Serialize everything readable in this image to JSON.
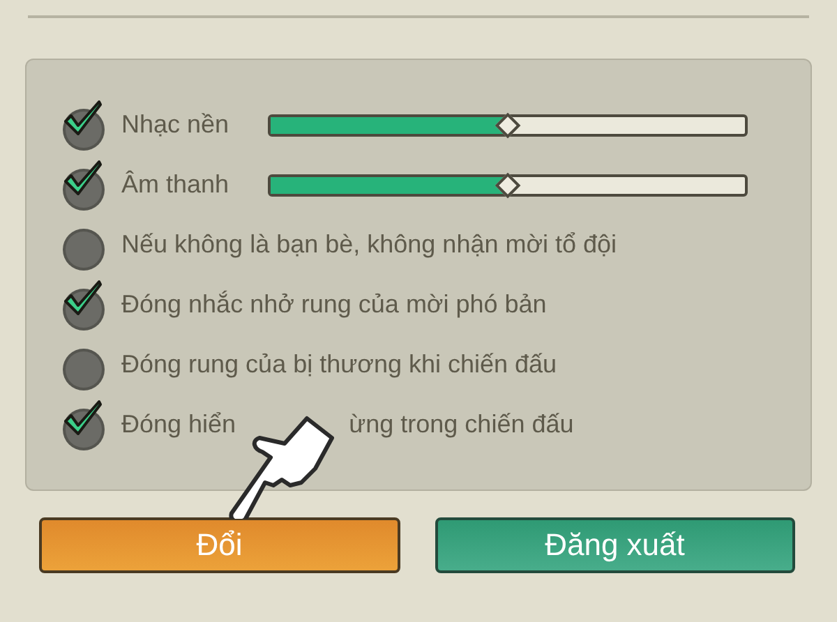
{
  "settings": [
    {
      "kind": "slider",
      "label": "Nhạc nền",
      "checked": true,
      "level": 0.5
    },
    {
      "kind": "slider",
      "label": "Âm thanh",
      "checked": true,
      "level": 0.5
    },
    {
      "kind": "toggle",
      "label": "Nếu không là bạn bè, không nhận mời tổ đội",
      "checked": false
    },
    {
      "kind": "toggle",
      "label": "Đóng nhắc nhở rung của mời phó bản",
      "checked": true
    },
    {
      "kind": "toggle",
      "label": "Đóng rung của bị thương khi chiến đấu",
      "checked": false
    },
    {
      "kind": "toggle",
      "label_parts": [
        "Đóng hiển",
        "ừng trong chiến đấu"
      ],
      "checked": true
    }
  ],
  "buttons": [
    {
      "label": "Đổi",
      "kind": "orange"
    },
    {
      "label": "Đăng xuất",
      "kind": "green"
    }
  ]
}
